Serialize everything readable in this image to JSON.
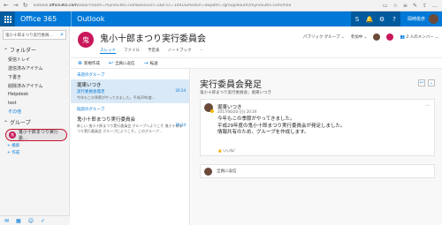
{
  "chrome": {
    "url_prefix": "outlook.",
    "url_domain": "office365.com",
    "url_rest": "/owa/?realm=mynex365.com&exsvurl=1&ll-cc=1041&modurl=0&path=/group/koumi/mynex365.com/mail"
  },
  "appbar": {
    "app_name": "Office 365",
    "module": "Outlook",
    "user_name": "岡崎俊彦"
  },
  "left": {
    "search_value": "鬼小十郎まつり実行委員…",
    "folder_header": "フォルダー",
    "folders": [
      "受信トレイ",
      "送信済みアイテム",
      "下書き",
      "削除済みアイテム",
      "Helpdesk",
      "test"
    ],
    "more_link": "その他",
    "groups_header": "グループ",
    "group_item": "鬼小十郎まつり実行委…",
    "group_avatar": "鬼",
    "discover_link": "検索",
    "create_link": "作成"
  },
  "group": {
    "avatar": "鬼",
    "title": "鬼小十郎まつり実行委員会",
    "tabs": [
      "スレッド",
      "ファイル",
      "予定表",
      "ノートブック",
      "…"
    ],
    "privacy": "パブリック グループ",
    "join_label": "参加中",
    "members_label": "2 人のメンバー"
  },
  "commands": {
    "new": "新規作成",
    "reply_all": "全員に返信",
    "forward": "転送"
  },
  "list": {
    "header_top": "未読のグループ",
    "header_other": "既読のグループ",
    "messages": [
      {
        "from": "堀東いつき",
        "subject": "実行委員会発足",
        "preview": "今年もこの季節がやってきました。平成29年度…",
        "time": "20:34"
      },
      {
        "from": "鬼小十郎まつり実行委員会",
        "subject": "",
        "preview": "新しい 鬼小十郎まつり実行委員会 グループへようこそ 鬼小十郎まつり実行委員会 グループにようこそ。このグループ…",
        "time": "20:34"
      }
    ]
  },
  "read": {
    "title": "実行委員会発足",
    "subtitle": "鬼小十郎まつり実行委員会；堀東いつき",
    "post": {
      "name": "堀東いつき",
      "date": "2017/06/20 (日) 20:34",
      "lines": [
        "今年もこの季節がやってきました。",
        "平成29年度の鬼小十郎まつり実行委員会が発足しました。",
        "情報共有のため、グループを作成します。"
      ],
      "like": "いいね!"
    },
    "reply_placeholder": "全員に返信"
  }
}
